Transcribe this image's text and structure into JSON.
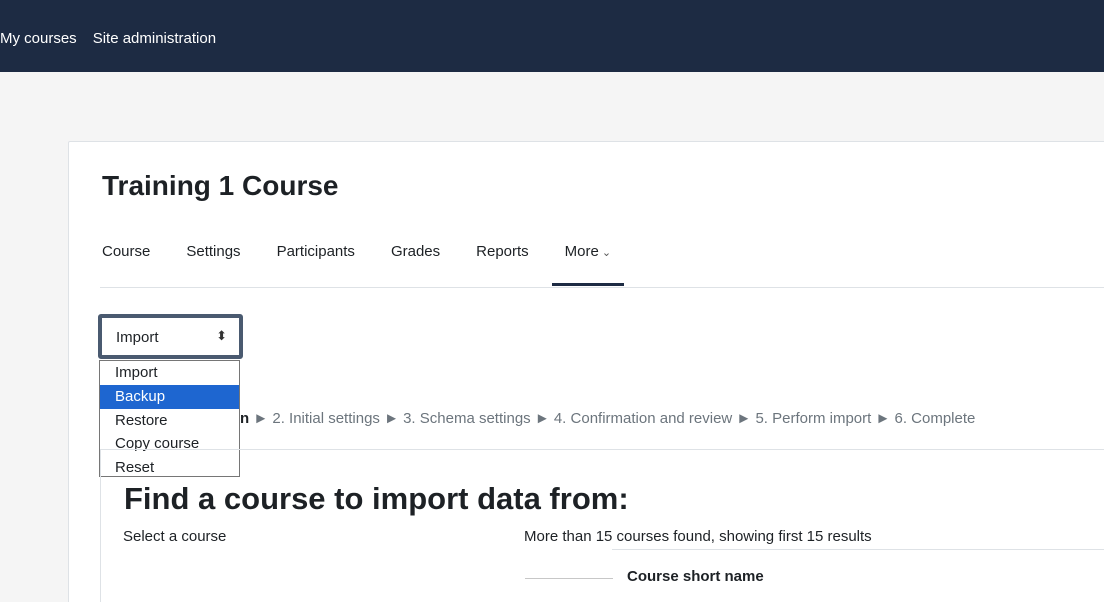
{
  "topnav": {
    "items": [
      "My courses",
      "Site administration"
    ]
  },
  "page": {
    "title": "Training 1 Course"
  },
  "tabs": [
    {
      "label": "Course"
    },
    {
      "label": "Settings"
    },
    {
      "label": "Participants"
    },
    {
      "label": "Grades"
    },
    {
      "label": "Reports"
    },
    {
      "label": "More"
    }
  ],
  "action_select": {
    "value": "Import",
    "options": [
      "Import",
      "Backup",
      "Restore",
      "Copy course",
      "Reset"
    ],
    "highlighted": "Backup"
  },
  "steps": {
    "current_fragment": "n",
    "rest": "► 2. Initial settings ► 3. Schema settings ► 4. Confirmation and review ► 5. Perform import ► 6. Complete"
  },
  "find": {
    "heading": "Find a course to import data from:",
    "select_label": "Select a course",
    "results_text": "More than 15 courses found, showing first 15 results",
    "column_header": "Course short name"
  },
  "colors": {
    "topbar": "#1d2b43",
    "highlight": "#1e66d0"
  }
}
